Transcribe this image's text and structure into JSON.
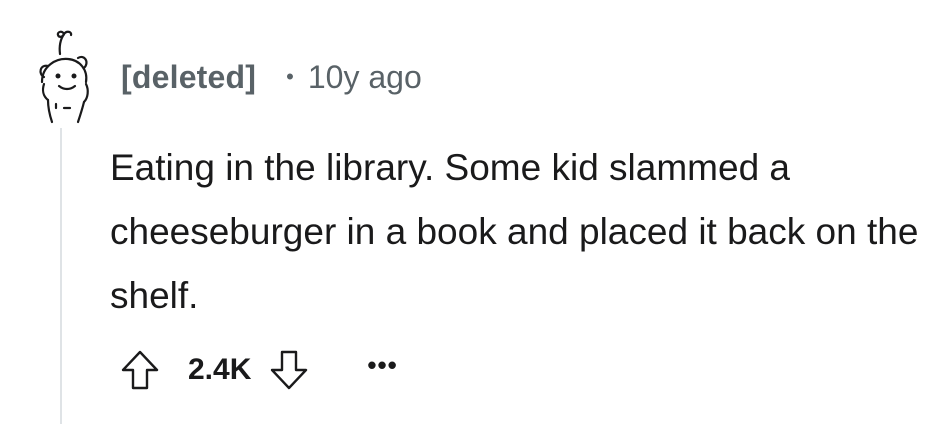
{
  "comment": {
    "author": "[deleted]",
    "separator": "•",
    "age": "10y ago",
    "body": "Eating in the library. Some kid slammed a cheeseburger in a book and placed it back on the shelf.",
    "score": "2.4K",
    "more_label": "•••"
  },
  "icons": {
    "avatar": "snoo-avatar-icon",
    "upvote": "upvote-arrow-icon",
    "downvote": "downvote-arrow-icon",
    "more": "more-options-icon"
  },
  "colors": {
    "meta_text": "#596267",
    "body_text": "#1a1a1b",
    "thread_line": "#dfe3e6"
  }
}
